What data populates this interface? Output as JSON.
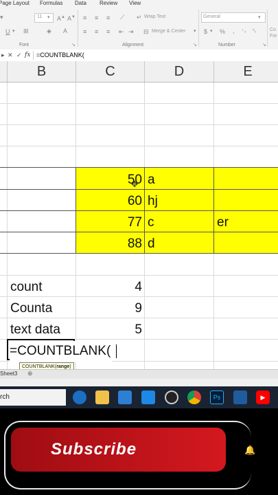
{
  "ribbon": {
    "tabs": [
      "Page Layout",
      "Formulas",
      "Data",
      "Review",
      "View"
    ],
    "font_size": "11",
    "wrap_text": "Wrap Text",
    "merge_center": "Merge & Center",
    "number_format": "General",
    "groups": {
      "font": "Font",
      "alignment": "Alignment",
      "number": "Number"
    },
    "partial_right_1": "Co",
    "partial_right_2": "For"
  },
  "formula_bar": {
    "fx": "fx",
    "formula": "=COUNTBLANK("
  },
  "columns": [
    "B",
    "C",
    "D",
    "E"
  ],
  "cells": {
    "c1": "50",
    "d1": "a",
    "c2": "60",
    "d2": "hj",
    "c3": "77",
    "d3": "c",
    "e3": "er",
    "c4": "88",
    "d4": "d",
    "b_count": "count",
    "c_count": "4",
    "b_counta": "Counta",
    "c_counta": "9",
    "b_text": "text data",
    "c_text": "5",
    "editing": "=COUNTBLANK("
  },
  "tooltip": {
    "func": "COUNTBLANK(",
    "arg": "range",
    "close": ")"
  },
  "sheet_tab": "Sheet3",
  "taskbar": {
    "search_text": "rch"
  },
  "subscribe": {
    "label": "Subscribe"
  },
  "colors": {
    "highlight": "#ffff00",
    "subscribe": "#c8151b",
    "taskbar": "#1a2332"
  }
}
